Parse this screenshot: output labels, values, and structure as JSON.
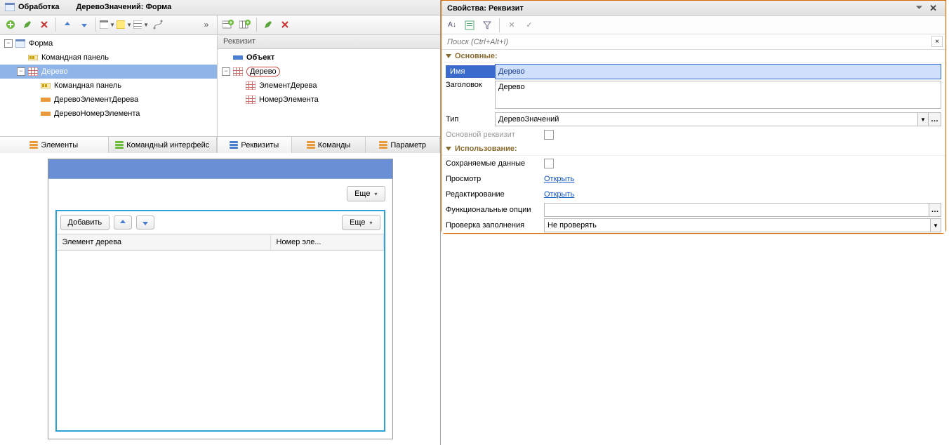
{
  "window": {
    "title_prefix": "Обработка",
    "title_object": "ДеревоЗначений: Форма"
  },
  "left_tree": {
    "items": [
      {
        "label": "Форма",
        "icon": "form",
        "indent": 0,
        "expander": true
      },
      {
        "label": "Командная панель",
        "icon": "cmdbar",
        "indent": 1
      },
      {
        "label": "Дерево",
        "icon": "tree",
        "indent": 1,
        "expander": true,
        "selected": true
      },
      {
        "label": "Командная панель",
        "icon": "cmdbar",
        "indent": 2
      },
      {
        "label": "ДеревоЭлементДерева",
        "icon": "orange",
        "indent": 2
      },
      {
        "label": "ДеревоНомерЭлемента",
        "icon": "orange",
        "indent": 2
      }
    ],
    "tabs": [
      {
        "label": "Элементы",
        "color": "orange",
        "active": true
      },
      {
        "label": "Командный интерфейс",
        "color": "green"
      }
    ]
  },
  "mid_tree": {
    "header": "Реквизит",
    "items": [
      {
        "label": "Объект",
        "icon": "blue",
        "indent": 0,
        "bold": true
      },
      {
        "label": "Дерево",
        "icon": "grid",
        "indent": 0,
        "expander": true,
        "circled": true
      },
      {
        "label": "ЭлементДерева",
        "icon": "grid",
        "indent": 1
      },
      {
        "label": "НомерЭлемента",
        "icon": "grid",
        "indent": 1
      }
    ],
    "tabs": [
      {
        "label": "Реквизиты",
        "color": "blue",
        "active": true
      },
      {
        "label": "Команды",
        "color": "orange"
      },
      {
        "label": "Параметр",
        "color": "orange"
      }
    ]
  },
  "preview": {
    "more_btn": "Еще",
    "add_btn": "Добавить",
    "col1": "Элемент дерева",
    "col2": "Номер эле..."
  },
  "props": {
    "title": "Свойства: Реквизит",
    "search_placeholder": "Поиск (Ctrl+Alt+I)",
    "sections": {
      "main": "Основные:",
      "usage": "Использование:"
    },
    "labels": {
      "name": "Имя",
      "header": "Заголовок",
      "type": "Тип",
      "main_attr": "Основной реквизит",
      "saved": "Сохраняемые данные",
      "view": "Просмотр",
      "edit": "Редактирование",
      "funcopt": "Функциональные опции",
      "fillcheck": "Проверка заполнения"
    },
    "values": {
      "name": "Дерево",
      "header": "Дерево",
      "type": "ДеревоЗначений",
      "view": "Открыть",
      "edit": "Открыть",
      "funcopt": "",
      "fillcheck": "Не проверять"
    }
  }
}
